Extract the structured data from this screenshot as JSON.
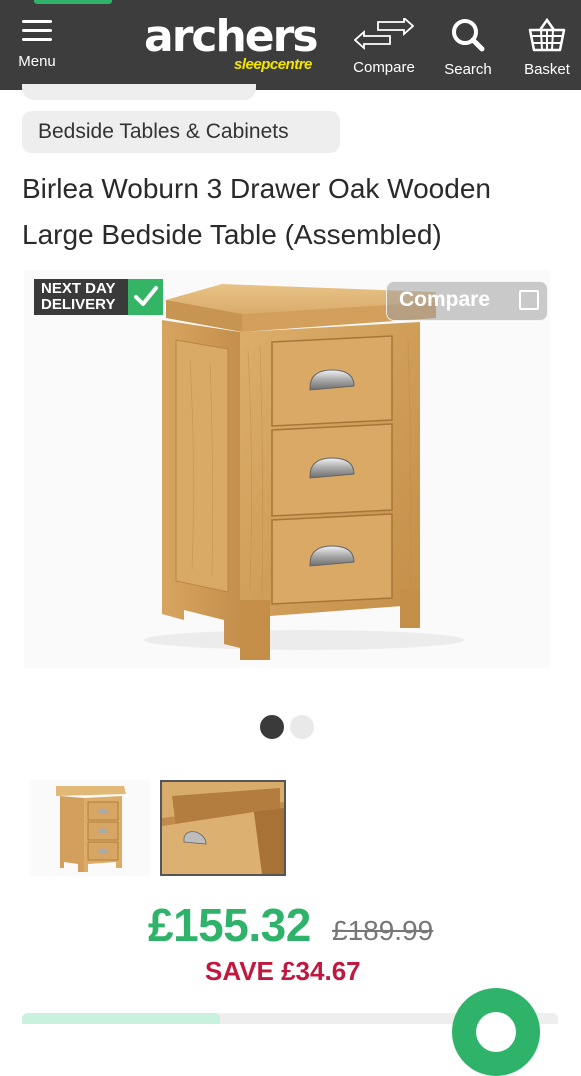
{
  "header": {
    "menu_label": "Menu",
    "logo_main": "archers",
    "logo_sub": "sleepcentre",
    "compare_label": "Compare",
    "search_label": "Search",
    "basket_label": "Basket"
  },
  "breadcrumb": {
    "category": "Bedside Tables & Cabinets"
  },
  "product": {
    "title": "Birlea Woburn 3 Drawer Oak Wooden Large Bedside Table (Assembled)",
    "badge_line1": "NEXT DAY",
    "badge_line2": "DELIVERY",
    "compare_toggle_label": "Compare",
    "price": "£155.32",
    "was_price": "£189.99",
    "save_text": "SAVE £34.67"
  },
  "gallery": {
    "slide_count": 2,
    "active_slide": 1
  },
  "colors": {
    "header_bg": "#3d3d3d",
    "brand_green": "#2fb36b",
    "logo_yellow": "#f2e600",
    "save_red": "#c0183e"
  }
}
